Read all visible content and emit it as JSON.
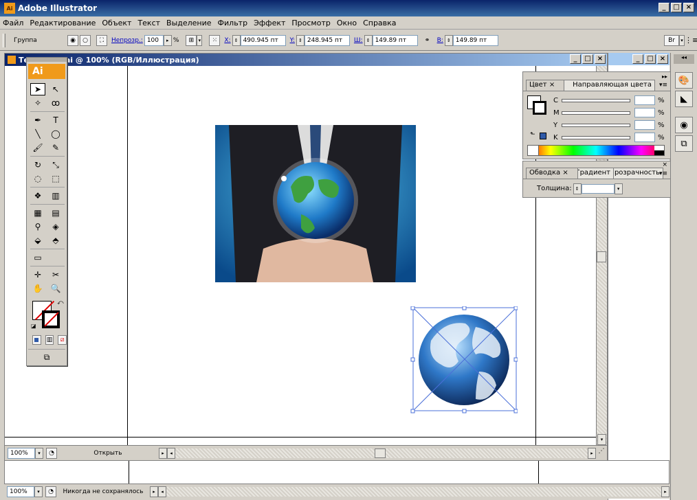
{
  "window": {
    "title": "Adobe Illustrator",
    "app_icon": "Ai"
  },
  "menu": [
    "Файл",
    "Редактирование",
    "Объект",
    "Текст",
    "Выделение",
    "Фильтр",
    "Эффект",
    "Просмотр",
    "Окно",
    "Справка"
  ],
  "control": {
    "selection_label": "Группа",
    "opacity_label": "Непрозр.:",
    "opacity_value": "100",
    "opacity_unit": "%",
    "x_label": "X:",
    "x_value": "490.945 пт",
    "y_label": "Y:",
    "y_value": "248.945 пт",
    "w_label": "Ш:",
    "w_value": "149.89 пт",
    "h_label": "В:",
    "h_value": "149.89 пт"
  },
  "document": {
    "title": "Те...нтуру.ai @ 100% (RGB/Иллюстрация)",
    "zoom": "100%",
    "status": "Открыть"
  },
  "background_document": {
    "zoom": "100%",
    "status": "Никогда не сохранялось"
  },
  "toolbox": {
    "logo": "Ai"
  },
  "color_panel": {
    "tab_active": "Цвет",
    "tab_inactive": "Направляющая цвета",
    "channels": [
      {
        "label": "C",
        "value": ""
      },
      {
        "label": "M",
        "value": ""
      },
      {
        "label": "Y",
        "value": ""
      },
      {
        "label": "K",
        "value": ""
      }
    ],
    "unit": "%"
  },
  "stroke_panel": {
    "tab_active": "Обводка",
    "tab_inactive": "Градиент",
    "tab_inactive2": "Прозрачность",
    "weight_label": "Толщина:",
    "weight_value": ""
  },
  "colors": {
    "accent": "#f09a1a",
    "selection": "#4a6fd8",
    "title_start": "#0a246a"
  }
}
